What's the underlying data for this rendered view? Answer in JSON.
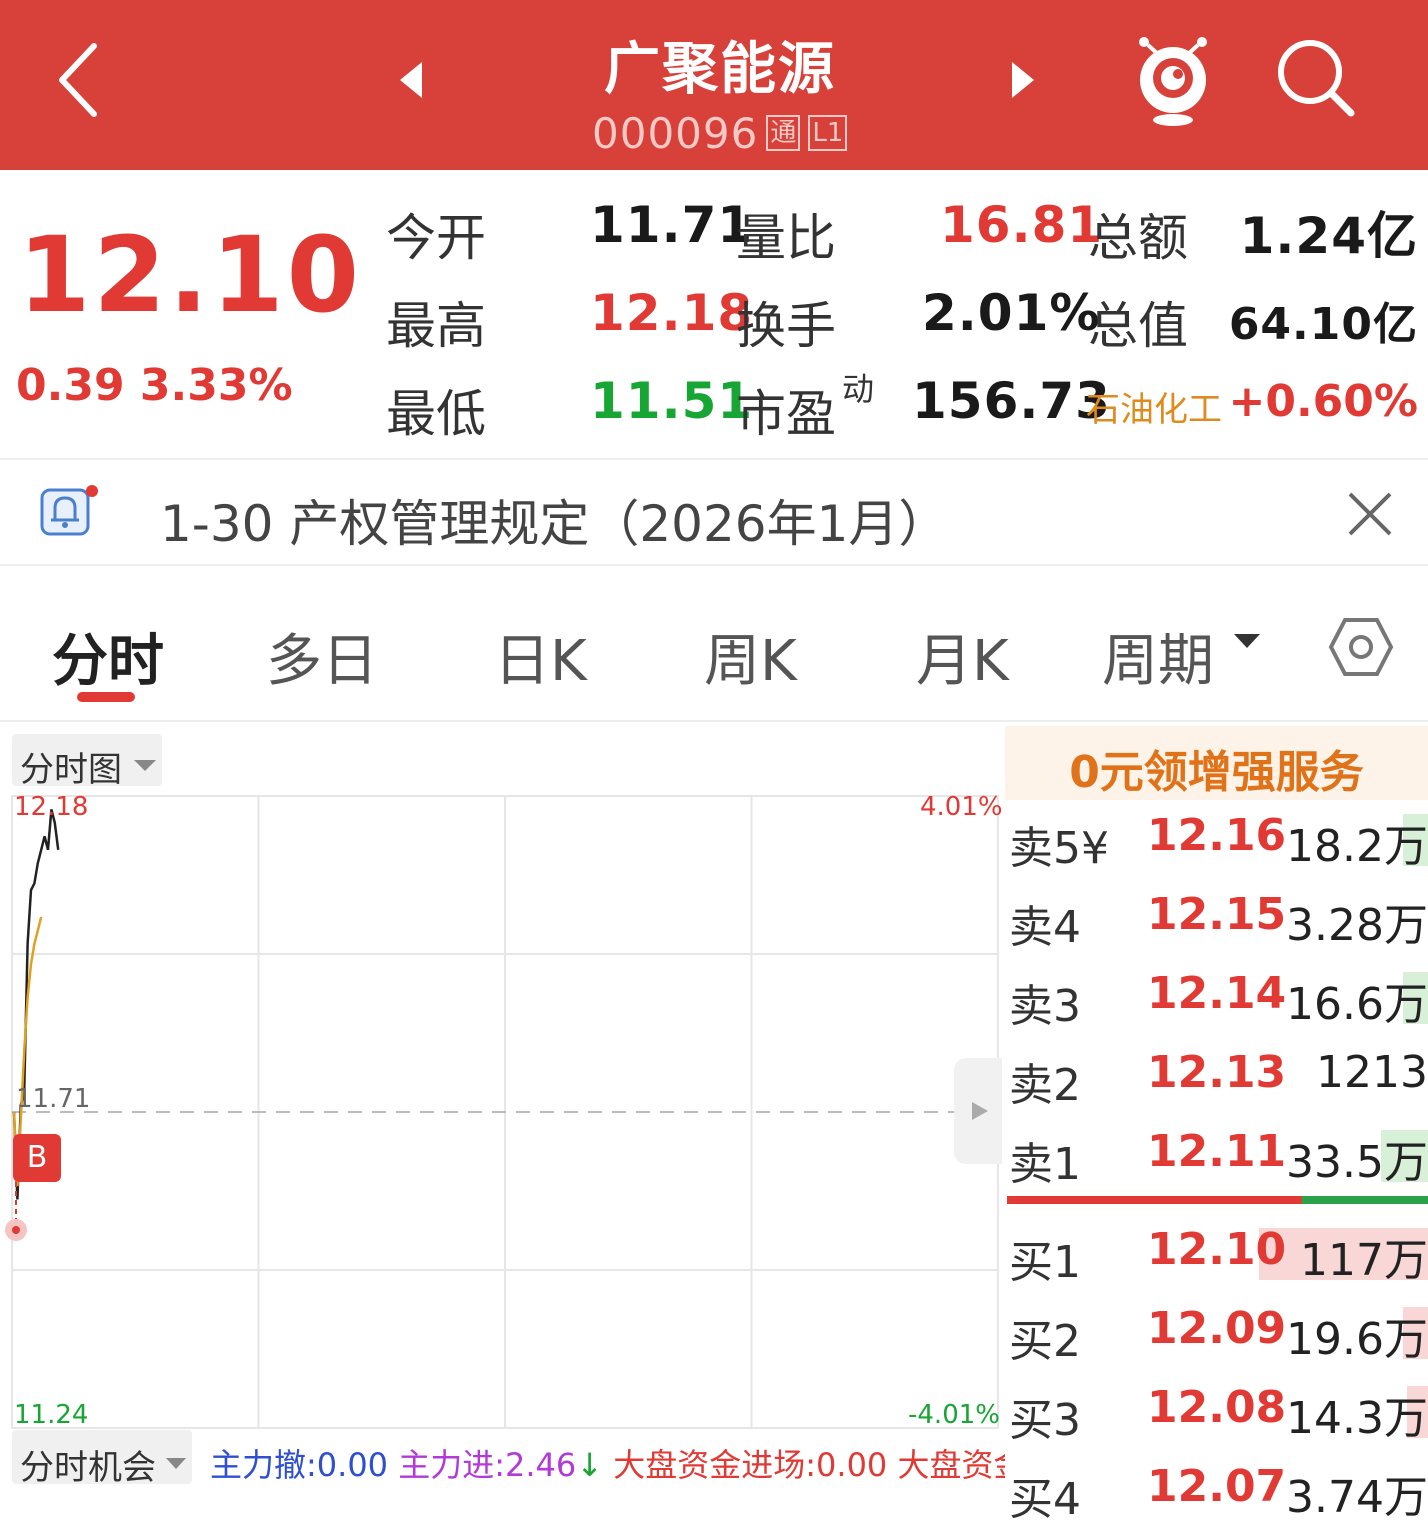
{
  "header": {
    "stock_name": "广聚能源",
    "stock_code": "000096",
    "badge_tong": "通",
    "badge_level": "L1"
  },
  "quote": {
    "price": "12.10",
    "change": "0.39",
    "change_pct": "3.33%",
    "stats": [
      {
        "label": "今开",
        "value": "11.71"
      },
      {
        "label": "量比",
        "value": "16.81"
      },
      {
        "label": "总额",
        "value": "1.24亿"
      },
      {
        "label": "最高",
        "value": "12.18"
      },
      {
        "label": "换手",
        "value": "2.01%"
      },
      {
        "label": "总值",
        "value": "64.10亿"
      },
      {
        "label": "最低",
        "value": "11.51"
      },
      {
        "label": "市盈",
        "value": "156.73"
      }
    ],
    "pe_superscript": "动",
    "sector_name": "石油化工",
    "sector_change": "+0.60%"
  },
  "notice": {
    "text": "1-30 产权管理规定（2026年1月）"
  },
  "tabs": [
    {
      "label": "分时",
      "active": true
    },
    {
      "label": "多日"
    },
    {
      "label": "日K"
    },
    {
      "label": "周K"
    },
    {
      "label": "月K"
    },
    {
      "label": "周期"
    }
  ],
  "chart": {
    "selector_label": "分时图",
    "y_top_label": "12.18",
    "y_mid_label": "11.71",
    "y_bottom_label": "11.24",
    "pct_top_label": "4.01%",
    "pct_bottom_label": "-4.01%",
    "marker_label": "B"
  },
  "chart_data": {
    "type": "line",
    "ylim": [
      11.24,
      12.18
    ],
    "reference_price": 11.71,
    "y_tick_labels": [
      "12.18",
      "11.71",
      "11.24"
    ],
    "right_tick_labels": [
      "4.01%",
      "-4.01%"
    ],
    "grid": true,
    "series": [
      {
        "color": "#222222",
        "values": [
          11.71,
          11.58,
          11.72,
          11.74,
          11.96,
          12.04,
          12.05,
          12.08,
          12.1,
          12.12,
          12.1,
          12.16,
          12.14,
          12.1
        ]
      },
      {
        "color": "#e0a020",
        "values": [
          11.71,
          11.6,
          11.7,
          11.8,
          11.88,
          11.93,
          11.96,
          11.98,
          12.0
        ]
      }
    ]
  },
  "bottom_bar": {
    "selector_label": "分时机会",
    "item1": "主力撤:0.00",
    "item2": "主力进:2.46",
    "item3": "大盘资金进场:0.00",
    "item4": "大盘资金"
  },
  "orderbook": {
    "promo": "0元领增强服务",
    "sells": [
      {
        "label": "卖5¥",
        "price": "12.16",
        "volume": "18.2万",
        "bar": 0.06
      },
      {
        "label": "卖4",
        "price": "12.15",
        "volume": "3.28万",
        "bar": 0.0
      },
      {
        "label": "卖3",
        "price": "12.14",
        "volume": "16.6万",
        "bar": 0.06
      },
      {
        "label": "卖2",
        "price": "12.13",
        "volume": "1213",
        "bar": 0.0
      },
      {
        "label": "卖1",
        "price": "12.11",
        "volume": "33.5万",
        "bar": 0.11
      }
    ],
    "buys": [
      {
        "label": "买1",
        "price": "12.10",
        "volume": "117万",
        "bar": 0.4
      },
      {
        "label": "买2",
        "price": "12.09",
        "volume": "19.6万",
        "bar": 0.06
      },
      {
        "label": "买3",
        "price": "12.08",
        "volume": "14.3万",
        "bar": 0.05
      },
      {
        "label": "买4",
        "price": "12.07",
        "volume": "3.74万",
        "bar": 0.0
      }
    ],
    "divider_red_share": 0.7
  },
  "colors": {
    "header_bg": "#d8403a",
    "up": "#e13a35",
    "down": "#17a534",
    "promo_bg": "#fdf3e8",
    "promo_text": "#e0731a",
    "sector_text": "#e08a1e"
  }
}
